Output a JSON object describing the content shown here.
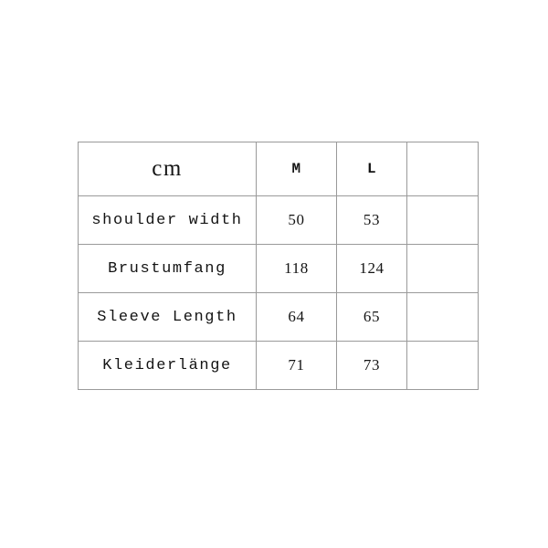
{
  "page": {
    "background_color": "#ffffff",
    "border_color": "#9a9a9a",
    "text_color": "#141414"
  },
  "table": {
    "name": "garment-size-chart",
    "unit_label": "cm",
    "columns": [
      {
        "key": "measurement",
        "label": "cm"
      },
      {
        "key": "m",
        "label": "M"
      },
      {
        "key": "l",
        "label": "L"
      },
      {
        "key": "extra",
        "label": ""
      }
    ],
    "rows": [
      {
        "label": "shoulder width",
        "m": "50",
        "l": "53",
        "extra": ""
      },
      {
        "label": "Brustumfang",
        "m": "118",
        "l": "124",
        "extra": ""
      },
      {
        "label": "Sleeve Length",
        "m": "64",
        "l": "65",
        "extra": ""
      },
      {
        "label": "Kleiderlänge",
        "m": "71",
        "l": "73",
        "extra": ""
      }
    ]
  },
  "chart_data": {
    "type": "table",
    "title": "",
    "unit": "cm",
    "categories": [
      "shoulder width",
      "Brustumfang",
      "Sleeve Length",
      "Kleiderlänge"
    ],
    "series": [
      {
        "name": "M",
        "values": [
          50,
          118,
          64,
          71
        ]
      },
      {
        "name": "L",
        "values": [
          53,
          124,
          65,
          73
        ]
      }
    ],
    "column_headers": [
      "cm",
      "M",
      "L",
      ""
    ],
    "grid": true,
    "legend": "none"
  }
}
